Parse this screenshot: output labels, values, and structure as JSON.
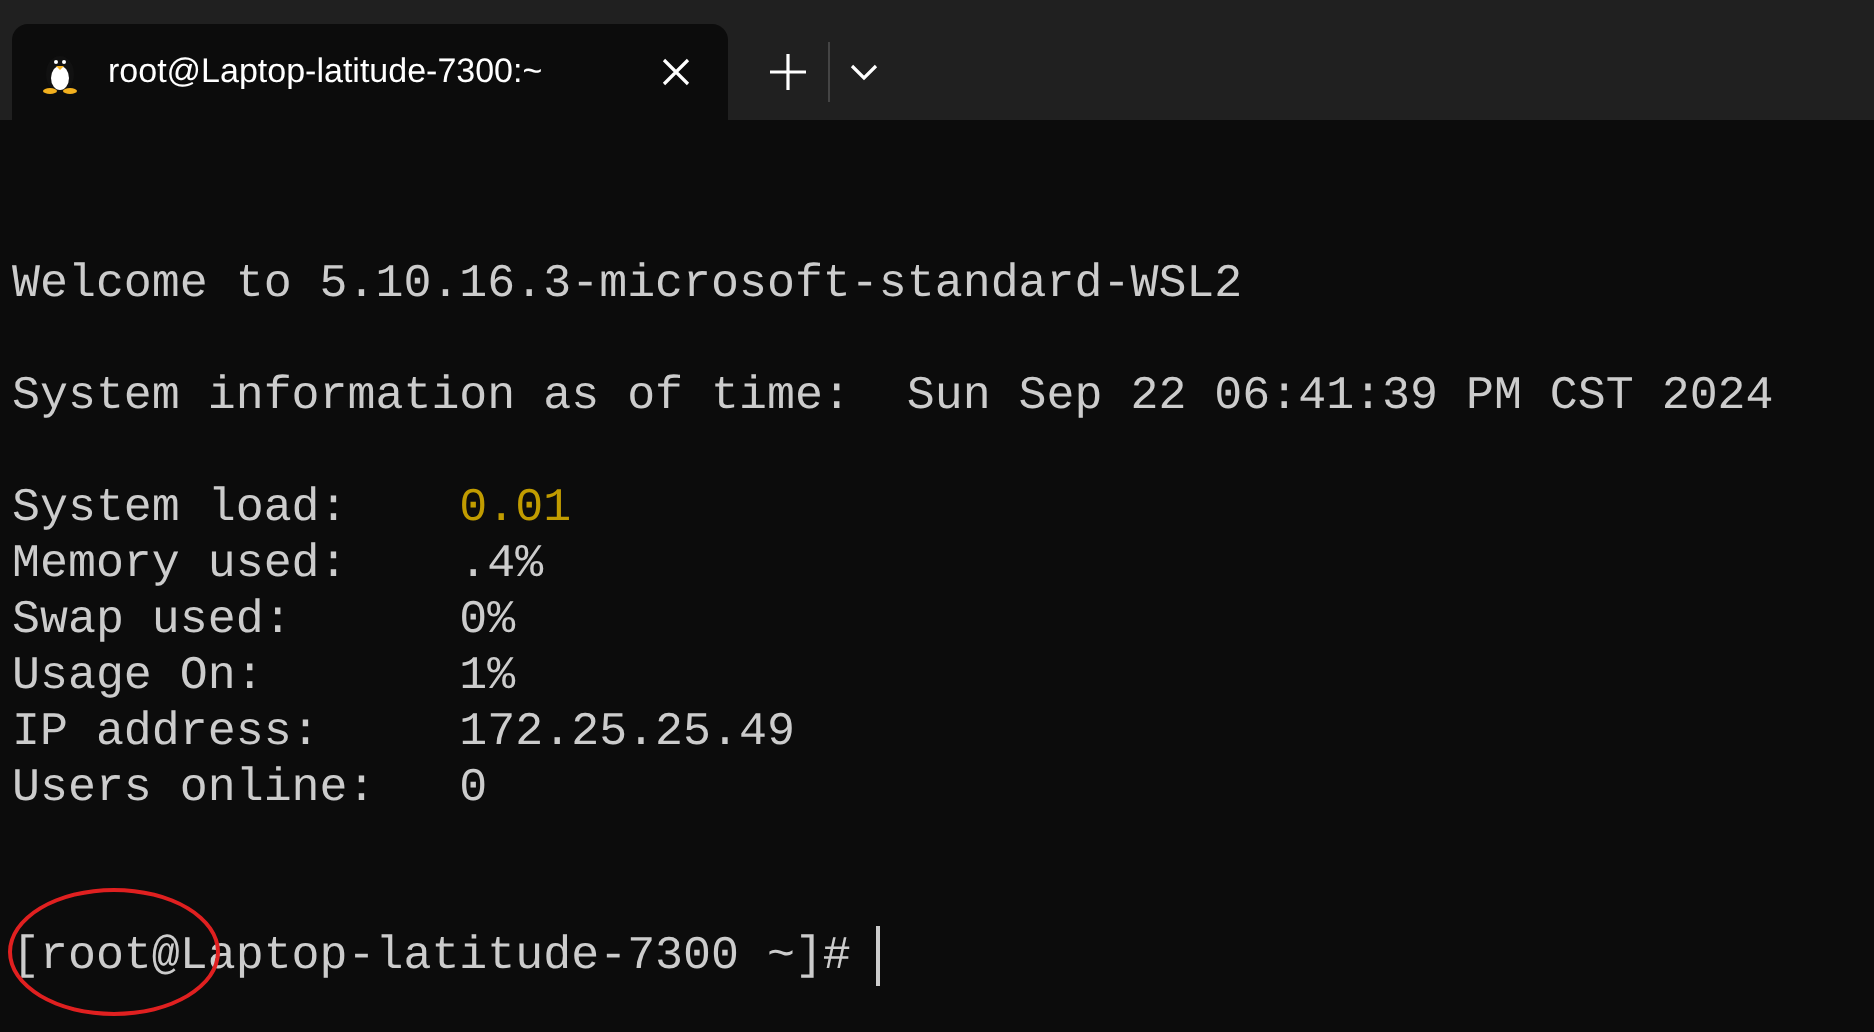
{
  "tabs": [
    {
      "title": "root@Laptop-latitude-7300:~",
      "selected": true
    }
  ],
  "terminal": {
    "lines": [
      {
        "kind": "text",
        "text": "Welcome to 5.10.16.3-microsoft-standard-WSL2"
      },
      {
        "kind": "blank"
      },
      {
        "kind": "text",
        "text": "System information as of time:  Sun Sep 22 06:41:39 PM CST 2024"
      },
      {
        "kind": "blank"
      },
      {
        "kind": "stat",
        "label": "System load:",
        "value": "0.01",
        "highlight": true
      },
      {
        "kind": "stat",
        "label": "Memory used:",
        "value": ".4%",
        "highlight": false
      },
      {
        "kind": "stat",
        "label": "Swap used:",
        "value": "0%",
        "highlight": false
      },
      {
        "kind": "stat",
        "label": "Usage On:",
        "value": "1%",
        "highlight": false
      },
      {
        "kind": "stat",
        "label": "IP address:",
        "value": "172.25.25.49",
        "highlight": false
      },
      {
        "kind": "stat",
        "label": "Users online:",
        "value": "0",
        "highlight": false
      },
      {
        "kind": "blank"
      },
      {
        "kind": "blank"
      },
      {
        "kind": "prompt",
        "text": "[root@Laptop-latitude-7300 ~]#",
        "circled": true
      }
    ]
  }
}
